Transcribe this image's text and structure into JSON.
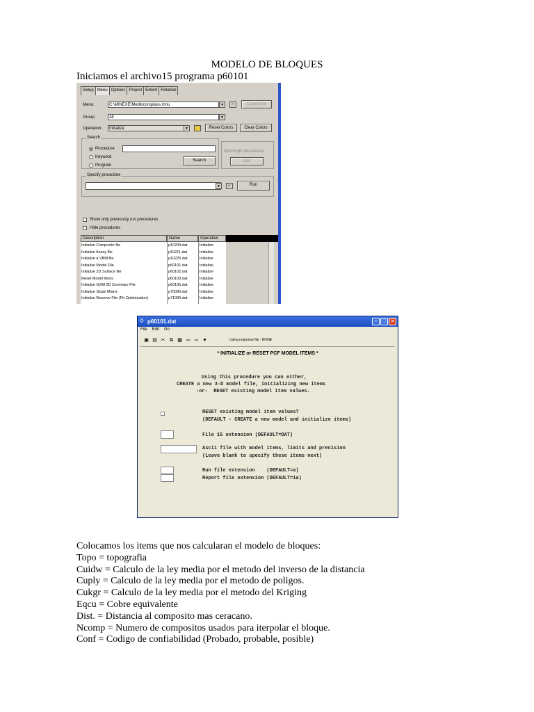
{
  "doc": {
    "title": "MODELO DE BLOQUES",
    "intro": "Iniciamos el archivo15 programa p60101",
    "body_lines": [
      "Colocamos los items que nos calcularan el modelo de bloques:",
      "Topo = topografia",
      "Cuidw = Calculo de la ley media por el metodo del inverso de la distancia",
      "Cuply = Calculo de la ley media por el metodo de poligos.",
      "Cukgr = Calculo de la ley media por el metodo del Kriging",
      "Eqcu =  Cobre equivalente",
      "Dist. =  Distancia al composito mas ceracano.",
      "Ncomp = Numero de compositos usados para iterpolar el bloque.",
      "Conf = Codigo de confiabilidad (Probado, probable, posible)"
    ]
  },
  "shot1": {
    "tabs": [
      "Setup",
      "Menu",
      "Options",
      "Project",
      "Extent",
      "Rotation"
    ],
    "menu_label": "Menu:",
    "menu_value": "C:\\MINEXE\\Medlocorsplass.mnu",
    "group_label": "Group:",
    "group_value": "All",
    "operation_label": "Operation:",
    "operation_value": "Initialize",
    "customize_label": "Customize",
    "reset_colors_label": "Reset Colors",
    "clear_colors_label": "Clear Colors",
    "search_legend": "Search",
    "radio_procedure": "Procedure",
    "radio_keyword": "Keyword",
    "radio_program": "Program",
    "search_label": "Search",
    "minesight_label": "MineSight procedures",
    "edit_label": "Edit",
    "specify_legend": "Specify procedure",
    "run_label": "Run",
    "show_only_label": "Show only previously run procedures",
    "hide_label": "Hide procedures",
    "col_description": "Description",
    "col_name": "Name",
    "col_operation": "Operation",
    "rows": [
      {
        "description": "Initialize Composite file",
        "name": "p10209.dat",
        "operation": "Initialize"
      },
      {
        "description": "Initialize Assay file",
        "name": "p10211.dat",
        "operation": "Initialize"
      },
      {
        "description": "Initialize a VBM file",
        "name": "p10225.dat",
        "operation": "Initialize"
      },
      {
        "description": "Initialize Model File",
        "name": "p60101.dat",
        "operation": "Initialize"
      },
      {
        "description": "Initialize 2D Surface file",
        "name": "p60102.dat",
        "operation": "Initialize"
      },
      {
        "description": "Reset Model Items",
        "name": "p60103.dat",
        "operation": "Initialize"
      },
      {
        "description": "Initialize GSM 2D Summary File",
        "name": "p60105.dat",
        "operation": "Initialize"
      },
      {
        "description": "Initialize Slope Matrix",
        "name": "p70090.dat",
        "operation": "Initialize"
      },
      {
        "description": "Initialize Reserve File (Pit Optimization)",
        "name": "p71090.dat",
        "operation": "Initialize"
      }
    ]
  },
  "shot2": {
    "window_title": "p60101.dat",
    "menu": [
      "File",
      "Edit",
      "Go"
    ],
    "response_file": "Using response file : NONE",
    "heading": "*  INITIALIZE or RESET PCF MODEL ITEMS  *",
    "intro_lines": [
      "Using this procedure you can either,",
      "CREATE a new 3-D model file, initializing new items",
      "-or-  RESET existing model item values."
    ],
    "reset_lines": [
      "RESET existing model item values?",
      "(DEFAULT - CREATE a new model and initialize items)"
    ],
    "file15_line": "File 15 extension (DEFAULT=DAT)",
    "ascii_lines": [
      "Ascii file with model items, limits and precision",
      "(Leave blank to specify these items next)"
    ],
    "run_line": "Run file extension    (DEFAULT=a)",
    "report_line": "Report file extension (DEFAULT=1a)"
  }
}
